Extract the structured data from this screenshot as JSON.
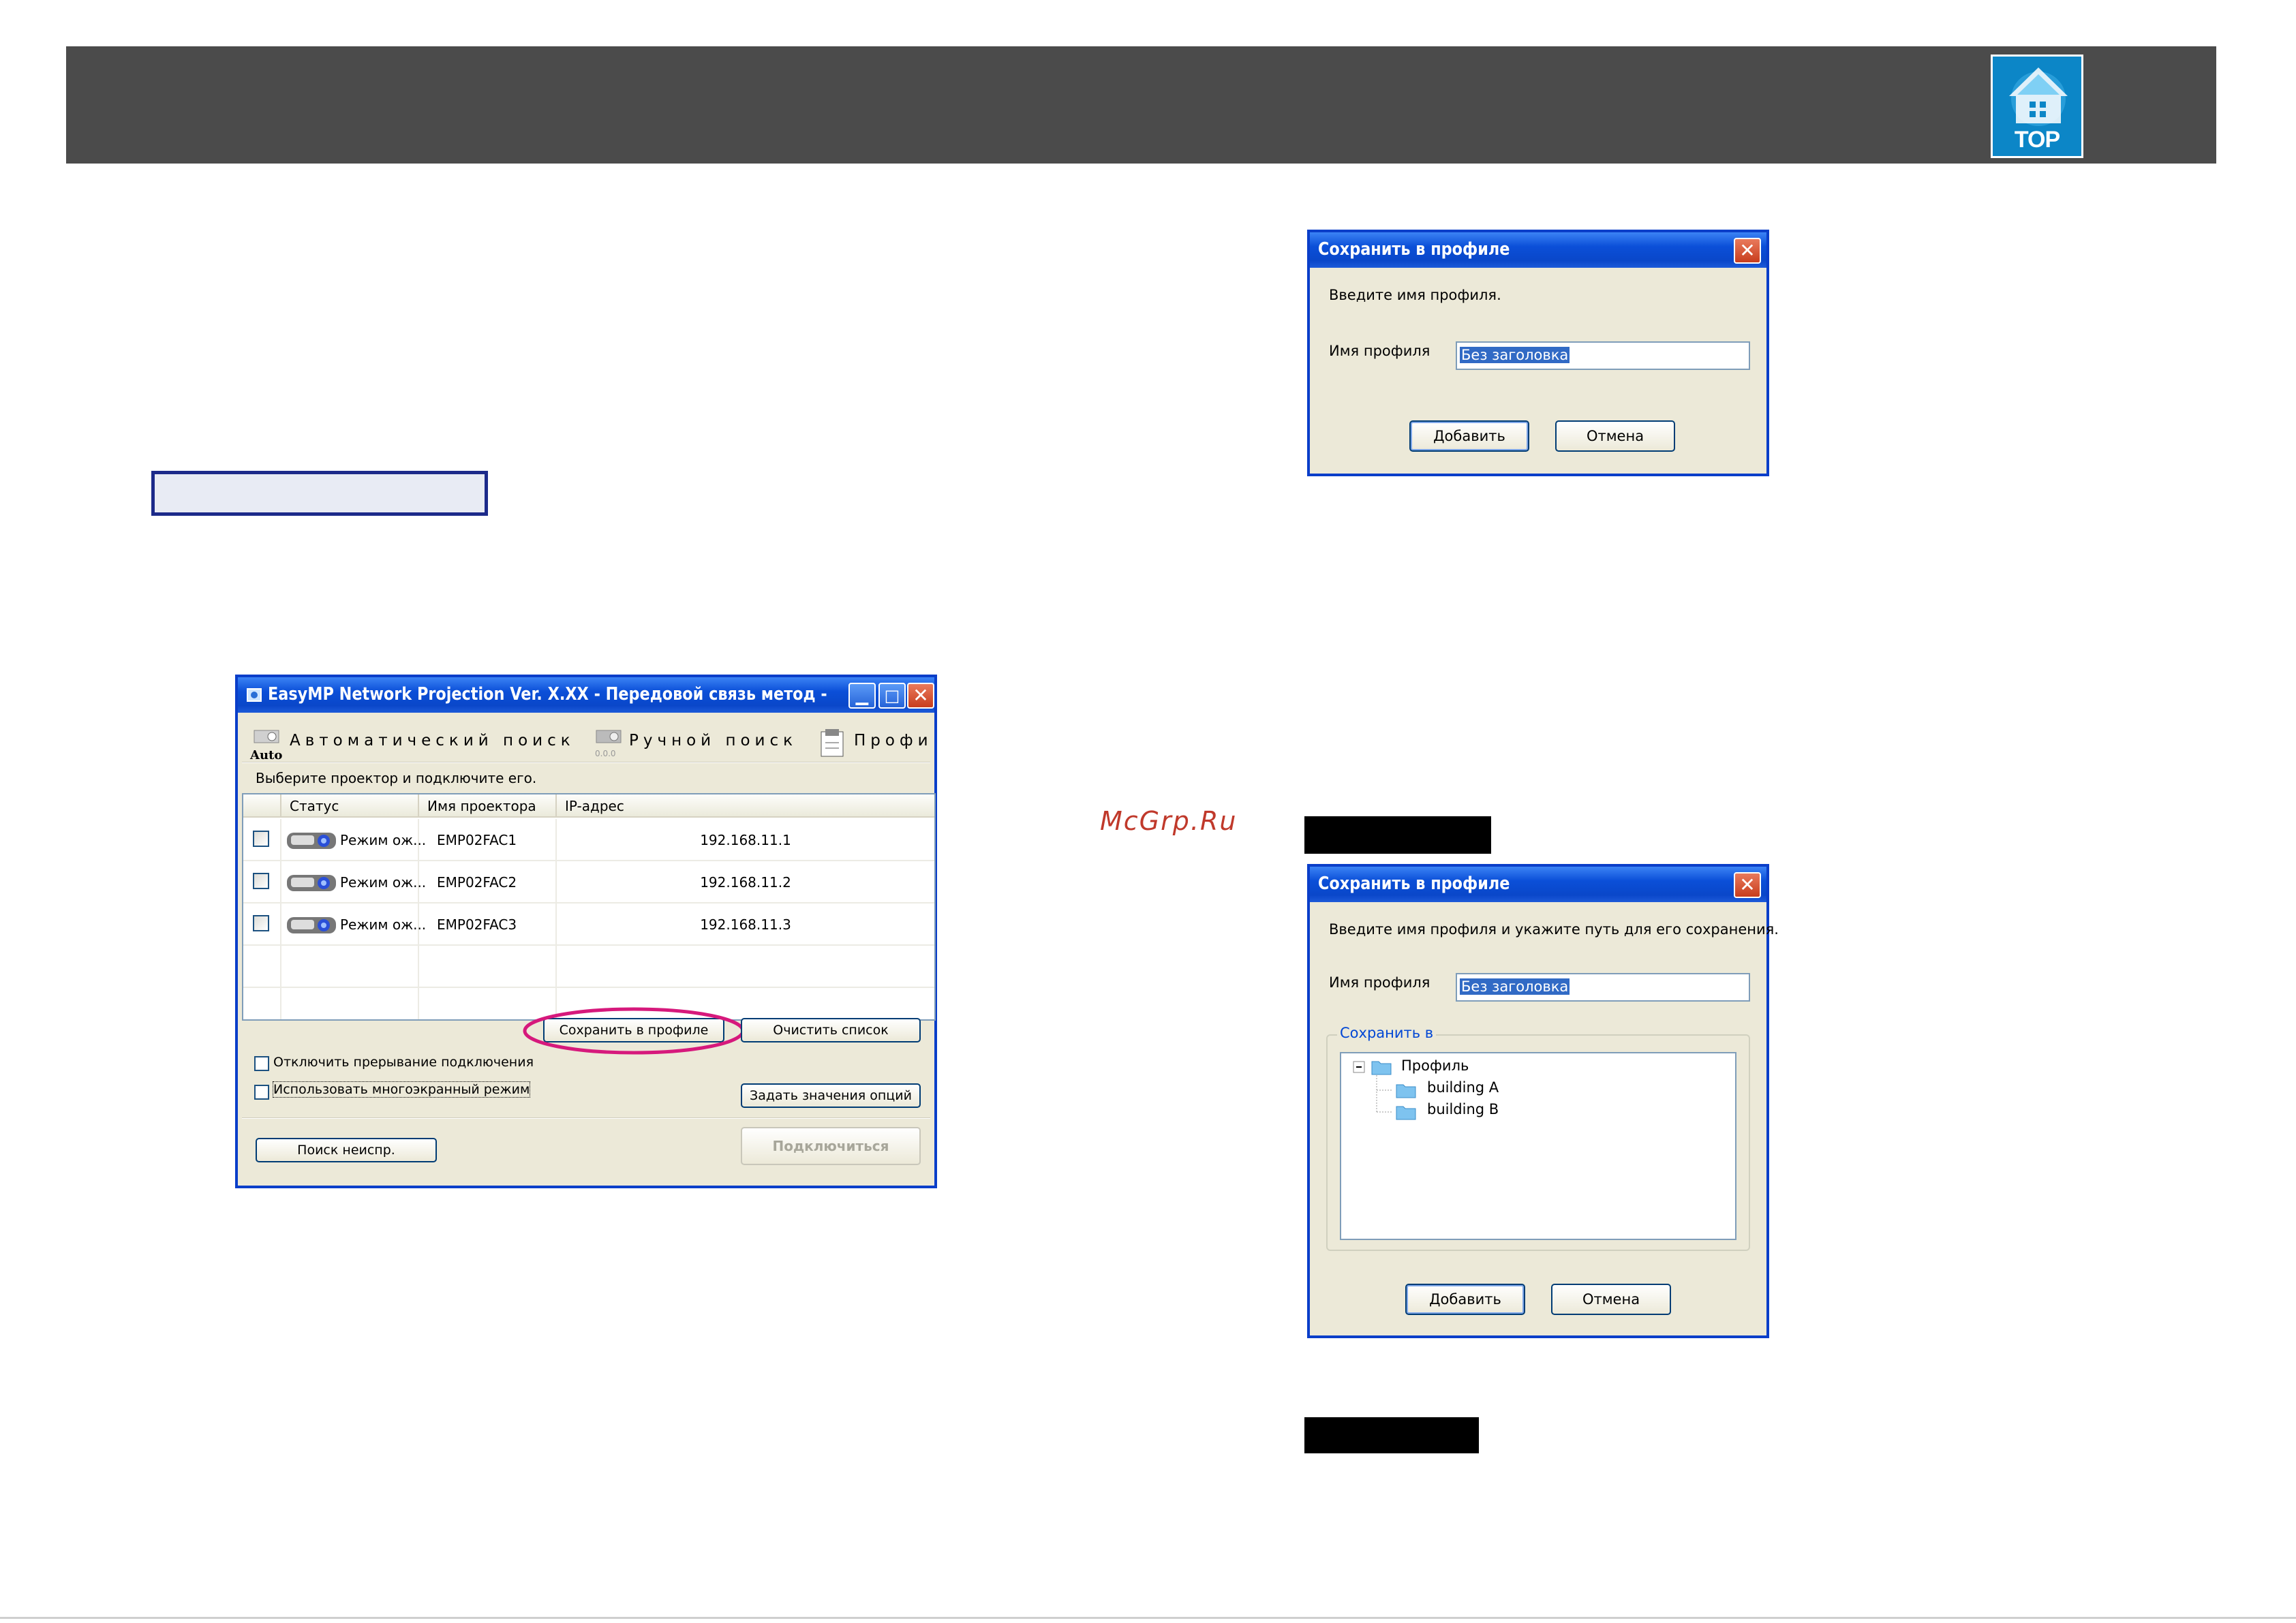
{
  "header": {
    "top_button_label": "TOP",
    "icon": "top-home-icon",
    "band_color": "#4b4b4b"
  },
  "watermark": "McGrp.Ru",
  "easymp": {
    "title": "EasyMP Network Projection Ver. X.XX - Передовой связь метод -",
    "toolbar": {
      "auto_icon_label": "Auto",
      "auto_search": "Автоматический поиск",
      "manual_search": "Ручной поиск",
      "profile": "Профи"
    },
    "prompt": "Выберите проектор и подключите его.",
    "columns": [
      "Статус",
      "Имя проектора",
      "IP-адрес"
    ],
    "rows": [
      {
        "status": "Режим ож...",
        "name": "EMP02FAC1",
        "ip": "192.168.11.1"
      },
      {
        "status": "Режим ож...",
        "name": "EMP02FAC2",
        "ip": "192.168.11.2"
      },
      {
        "status": "Режим ож...",
        "name": "EMP02FAC3",
        "ip": "192.168.11.3"
      }
    ],
    "save_profile_button": "Сохранить в профиле",
    "clear_list_button": "Очистить список",
    "disable_interrupt": "Отключить прерывание подключения",
    "multiscreen": "Использовать многоэкранный режим",
    "set_options_button": "Задать значения опций",
    "search_button": "Поиск неиспр.",
    "connect_button": "Подключиться",
    "highlight_color": "#d6197c"
  },
  "dialog1": {
    "title": "Сохранить в профиле",
    "instruction": "Введите имя профиля.",
    "name_label": "Имя профиля",
    "name_value": "Без заголовка",
    "add_button": "Добавить",
    "cancel_button": "Отмена"
  },
  "dialog2": {
    "title": "Сохранить в профиле",
    "instruction": "Введите имя профиля и укажите путь для его сохранения.",
    "name_label": "Имя профиля",
    "name_value": "Без заголовка",
    "save_in_label": "Сохранить в",
    "tree": {
      "root": "Профиль",
      "children": [
        "building A",
        "building B"
      ]
    },
    "add_button": "Добавить",
    "cancel_button": "Отмена"
  }
}
